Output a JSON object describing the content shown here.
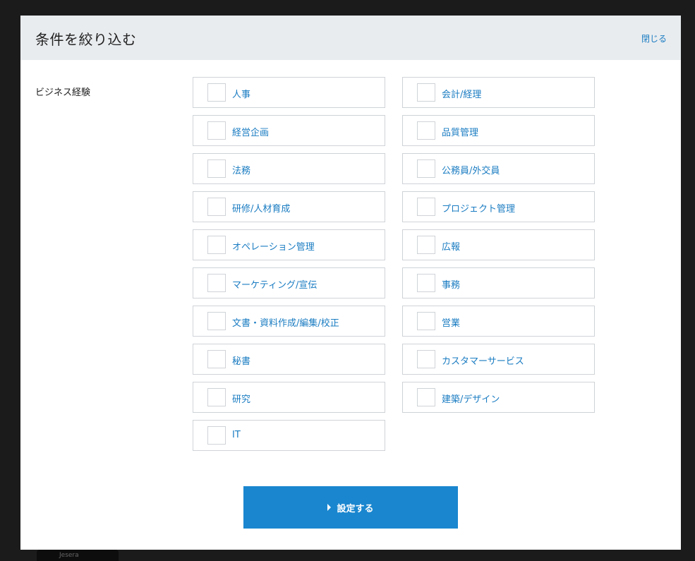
{
  "modal": {
    "title": "条件を絞り込む",
    "close_label": "閉じる",
    "section_label": "ビジネス経験",
    "options": [
      {
        "label": "人事",
        "checked": false
      },
      {
        "label": "会計/経理",
        "checked": false
      },
      {
        "label": "経営企画",
        "checked": false
      },
      {
        "label": "品質管理",
        "checked": false
      },
      {
        "label": "法務",
        "checked": false
      },
      {
        "label": "公務員/外交員",
        "checked": false
      },
      {
        "label": "研修/人材育成",
        "checked": false
      },
      {
        "label": "プロジェクト管理",
        "checked": false
      },
      {
        "label": "オペレーション管理",
        "checked": false
      },
      {
        "label": "広報",
        "checked": false
      },
      {
        "label": "マーケティング/宣伝",
        "checked": false
      },
      {
        "label": "事務",
        "checked": false
      },
      {
        "label": "文書・資料作成/編集/校正",
        "checked": false
      },
      {
        "label": "営業",
        "checked": false
      },
      {
        "label": "秘書",
        "checked": false
      },
      {
        "label": "カスタマーサービス",
        "checked": false
      },
      {
        "label": "研究",
        "checked": false
      },
      {
        "label": "建築/デザイン",
        "checked": false
      },
      {
        "label": "IT",
        "checked": false
      }
    ],
    "submit_label": "設定する"
  },
  "background": {
    "thumb_text": "Jesera"
  },
  "colors": {
    "accent": "#1a86cf",
    "link": "#1a7cc2",
    "header_bg": "#e9ecef",
    "overlay": "#1b1b1b"
  }
}
